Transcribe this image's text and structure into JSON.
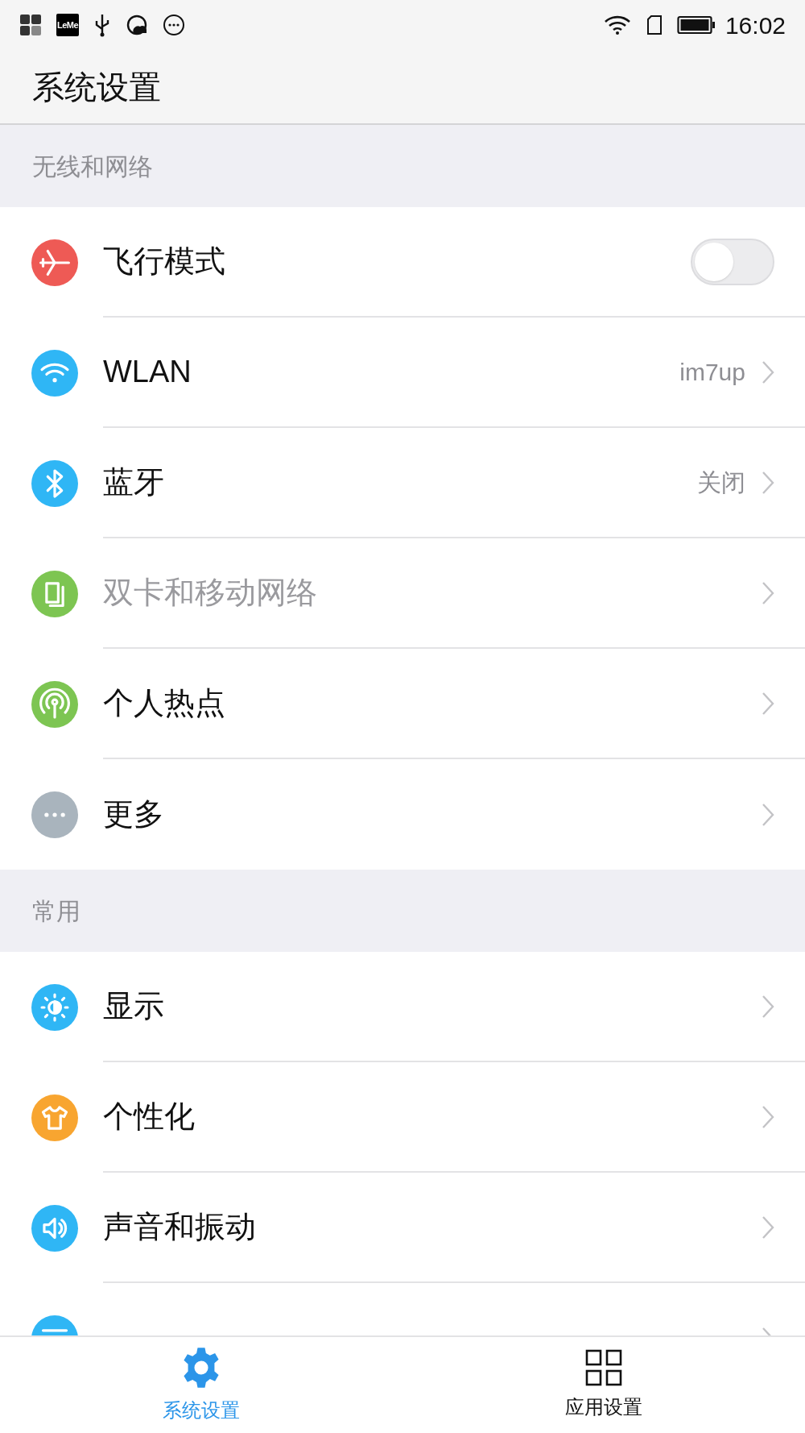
{
  "status_bar": {
    "time": "16:02",
    "leme_label": "LeMe"
  },
  "header": {
    "title": "系统设置"
  },
  "sections": [
    {
      "title": "无线和网络",
      "items": [
        {
          "label": "飞行模式",
          "kind": "toggle",
          "on": false,
          "disabled": false,
          "color": "#ee5a55"
        },
        {
          "label": "WLAN",
          "kind": "link",
          "value": "im7up",
          "disabled": false,
          "color": "#2fb6f5"
        },
        {
          "label": "蓝牙",
          "kind": "link",
          "value": "关闭",
          "disabled": false,
          "color": "#2fb6f5"
        },
        {
          "label": "双卡和移动网络",
          "kind": "link",
          "disabled": true,
          "color": "#7dc552"
        },
        {
          "label": "个人热点",
          "kind": "link",
          "disabled": false,
          "color": "#7dc552"
        },
        {
          "label": "更多",
          "kind": "link",
          "disabled": false,
          "color": "#a9b4bd"
        }
      ]
    },
    {
      "title": "常用",
      "items": [
        {
          "label": "显示",
          "kind": "link",
          "disabled": false,
          "color": "#2fb6f5"
        },
        {
          "label": "个性化",
          "kind": "link",
          "disabled": false,
          "color": "#f8a530"
        },
        {
          "label": "声音和振动",
          "kind": "link",
          "disabled": false,
          "color": "#2fb6f5"
        },
        {
          "kind": "link",
          "color": "#2fb6f5"
        }
      ]
    }
  ],
  "bottom_nav": [
    {
      "label": "系统设置",
      "selected": true
    },
    {
      "label": "应用设置",
      "selected": false
    }
  ]
}
